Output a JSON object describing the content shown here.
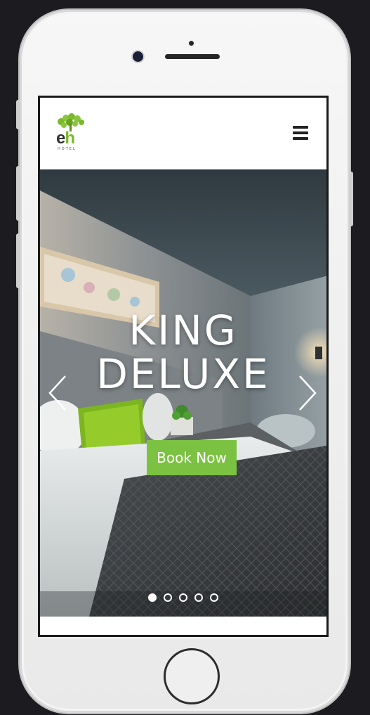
{
  "header": {
    "logo_text_e": "e",
    "logo_text_h": "h",
    "logo_subtext": "HOTEL",
    "menu_icon": "hamburger-menu-icon"
  },
  "hero": {
    "title_line1": "KING",
    "title_line2": "DELUXE",
    "cta_label": "Book Now",
    "prev_icon": "chevron-left-icon",
    "next_icon": "chevron-right-icon",
    "slide_count": 5,
    "active_slide": 1
  },
  "colors": {
    "accent": "#7cc242",
    "logo_green": "#7ab929",
    "logo_dark": "#333333",
    "page_background": "#1c1b20"
  }
}
